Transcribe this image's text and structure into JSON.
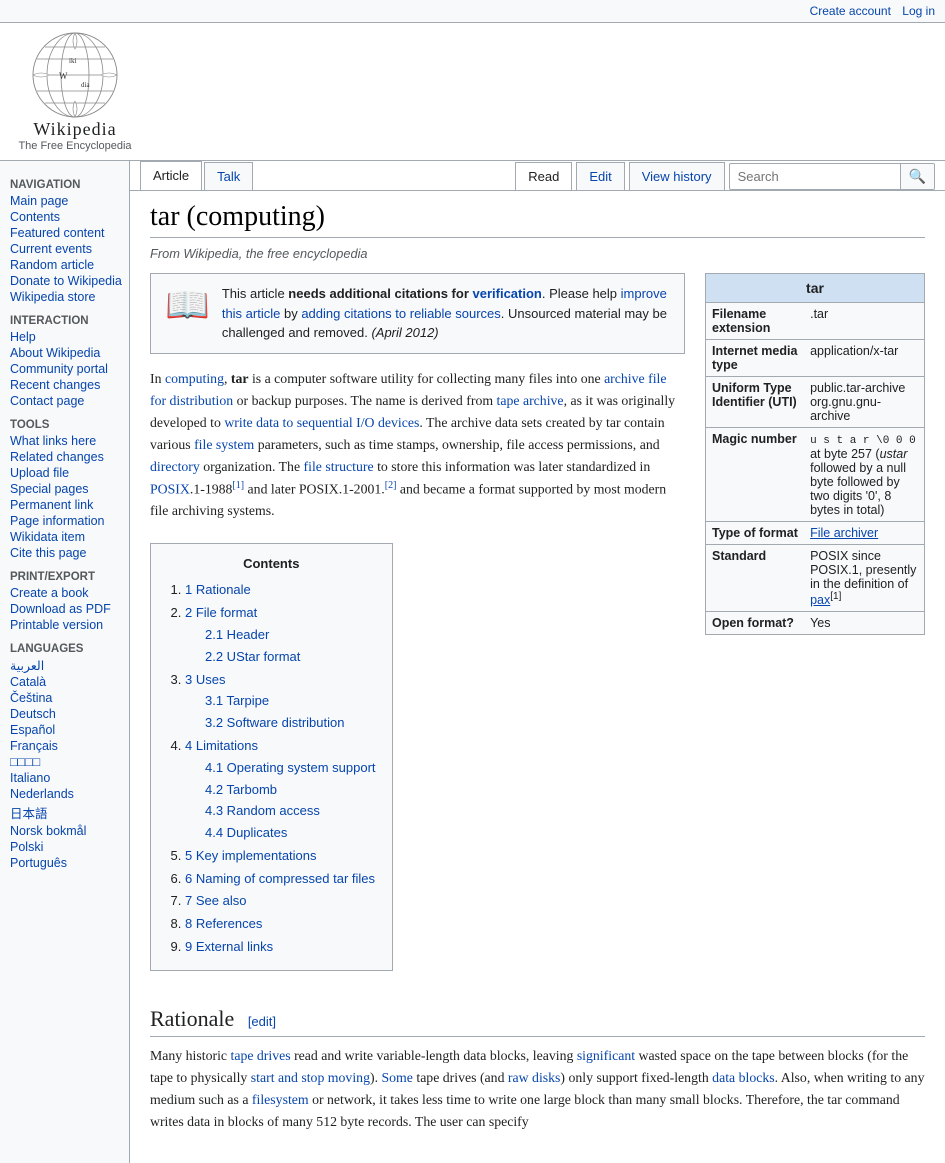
{
  "topbar": {
    "create_account": "Create account",
    "log_in": "Log in"
  },
  "logo": {
    "title": "Wikipedia",
    "subtitle": "The Free Encyclopedia"
  },
  "tabs": {
    "article": "Article",
    "talk": "Talk",
    "read": "Read",
    "edit": "Edit",
    "view_history": "View history"
  },
  "search": {
    "placeholder": "Search",
    "button_label": "🔍"
  },
  "sidebar": {
    "navigation_title": "Navigation",
    "items": [
      {
        "label": "Main page",
        "href": "#"
      },
      {
        "label": "Contents",
        "href": "#"
      },
      {
        "label": "Featured content",
        "href": "#"
      },
      {
        "label": "Current events",
        "href": "#"
      },
      {
        "label": "Random article",
        "href": "#"
      },
      {
        "label": "Donate to Wikipedia",
        "href": "#"
      },
      {
        "label": "Wikipedia store",
        "href": "#"
      }
    ],
    "interaction_title": "Interaction",
    "interaction_items": [
      {
        "label": "Help",
        "href": "#"
      },
      {
        "label": "About Wikipedia",
        "href": "#"
      },
      {
        "label": "Community portal",
        "href": "#"
      },
      {
        "label": "Recent changes",
        "href": "#"
      },
      {
        "label": "Contact page",
        "href": "#"
      }
    ],
    "tools_title": "Tools",
    "tools_items": [
      {
        "label": "What links here",
        "href": "#"
      },
      {
        "label": "Related changes",
        "href": "#"
      },
      {
        "label": "Upload file",
        "href": "#"
      },
      {
        "label": "Special pages",
        "href": "#"
      },
      {
        "label": "Permanent link",
        "href": "#"
      },
      {
        "label": "Page information",
        "href": "#"
      },
      {
        "label": "Wikidata item",
        "href": "#"
      },
      {
        "label": "Cite this page",
        "href": "#"
      }
    ],
    "print_title": "Print/export",
    "print_items": [
      {
        "label": "Create a book",
        "href": "#"
      },
      {
        "label": "Download as PDF",
        "href": "#"
      },
      {
        "label": "Printable version",
        "href": "#"
      }
    ],
    "languages_title": "Languages",
    "languages": [
      {
        "label": "العربية",
        "href": "#"
      },
      {
        "label": "Català",
        "href": "#"
      },
      {
        "label": "Čeština",
        "href": "#"
      },
      {
        "label": "Deutsch",
        "href": "#"
      },
      {
        "label": "Español",
        "href": "#"
      },
      {
        "label": "Français",
        "href": "#"
      },
      {
        "label": "□□□□",
        "href": "#"
      },
      {
        "label": "Italiano",
        "href": "#"
      },
      {
        "label": "Nederlands",
        "href": "#"
      },
      {
        "label": "日本語",
        "href": "#"
      },
      {
        "label": "Norsk bokmål",
        "href": "#"
      },
      {
        "label": "Polski",
        "href": "#"
      },
      {
        "label": "Português",
        "href": "#"
      }
    ]
  },
  "article": {
    "title": "tar (computing)",
    "from_text": "From Wikipedia, the free encyclopedia",
    "warning": {
      "text_before": "This article ",
      "needs_text": "needs additional citations for ",
      "verification": "verification",
      "text_after": ". Please help ",
      "improve_link": "improve this article",
      "by_text": " by ",
      "adding_link": "adding citations to reliable sources",
      "unsourced_text": ". Unsourced material may be challenged and removed.",
      "date": "(April 2012)"
    },
    "intro": "In computing, tar is a computer software utility for collecting many files into one archive file for distribution or backup purposes. The name is derived from tape archive, as it was originally developed to write data to sequential I/O devices. The archive data sets created by tar contain various file system parameters, such as time stamps, ownership, file access permissions, and directory organization. The file structure to store this information was later standardized in POSIX.1-1988[1] and later POSIX.1-2001.[2] and became a format supported by most modern file archiving systems.",
    "infobox": {
      "title": "tar",
      "rows": [
        {
          "label": "Filename extension",
          "value": ".tar"
        },
        {
          "label": "Internet media type",
          "value": "application/x-tar"
        },
        {
          "label": "Uniform Type Identifier (UTI)",
          "value": "public.tar-archive org.gnu.gnu-archive"
        },
        {
          "label": "Magic number",
          "value": "u s t a r \\0 0 0 at byte 257 (ustar followed by a null byte followed by two digits '0', 8 bytes in total)"
        },
        {
          "label": "Type of format",
          "value": "File archiver"
        },
        {
          "label": "Standard",
          "value": "POSIX since POSIX.1, presently in the definition of pax[1]"
        },
        {
          "label": "Open format?",
          "value": "Yes"
        }
      ]
    },
    "toc": {
      "title": "Contents",
      "items": [
        {
          "num": "1",
          "label": "Rationale",
          "href": "#rationale",
          "sub": []
        },
        {
          "num": "2",
          "label": "File format",
          "href": "#file-format",
          "sub": [
            {
              "num": "2.1",
              "label": "Header",
              "href": "#header"
            },
            {
              "num": "2.2",
              "label": "UStar format",
              "href": "#ustar-format"
            }
          ]
        },
        {
          "num": "3",
          "label": "Uses",
          "href": "#uses",
          "sub": [
            {
              "num": "3.1",
              "label": "Tarpipe",
              "href": "#tarpipe"
            },
            {
              "num": "3.2",
              "label": "Software distribution",
              "href": "#software-distribution"
            }
          ]
        },
        {
          "num": "4",
          "label": "Limitations",
          "href": "#limitations",
          "sub": [
            {
              "num": "4.1",
              "label": "Operating system support",
              "href": "#os-support"
            },
            {
              "num": "4.2",
              "label": "Tarbomb",
              "href": "#tarbomb"
            },
            {
              "num": "4.3",
              "label": "Random access",
              "href": "#random-access"
            },
            {
              "num": "4.4",
              "label": "Duplicates",
              "href": "#duplicates"
            }
          ]
        },
        {
          "num": "5",
          "label": "Key implementations",
          "href": "#key-implementations",
          "sub": []
        },
        {
          "num": "6",
          "label": "Naming of compressed tar files",
          "href": "#naming",
          "sub": []
        },
        {
          "num": "7",
          "label": "See also",
          "href": "#see-also",
          "sub": []
        },
        {
          "num": "8",
          "label": "References",
          "href": "#references",
          "sub": []
        },
        {
          "num": "9",
          "label": "External links",
          "href": "#external-links",
          "sub": []
        }
      ]
    },
    "rationale_section": {
      "title": "Rationale",
      "edit_label": "[edit]",
      "text": "Many historic tape drives read and write variable-length data blocks, leaving significant wasted space on the tape between blocks (for the tape to physically start and stop moving). Some tape drives (and raw disks) only support fixed-length data blocks. Also, when writing to any medium such as a filesystem or network, it takes less time to write one large block than many small blocks. Therefore, the tar command writes data in blocks of many 512 byte records. The user can specify"
    }
  }
}
